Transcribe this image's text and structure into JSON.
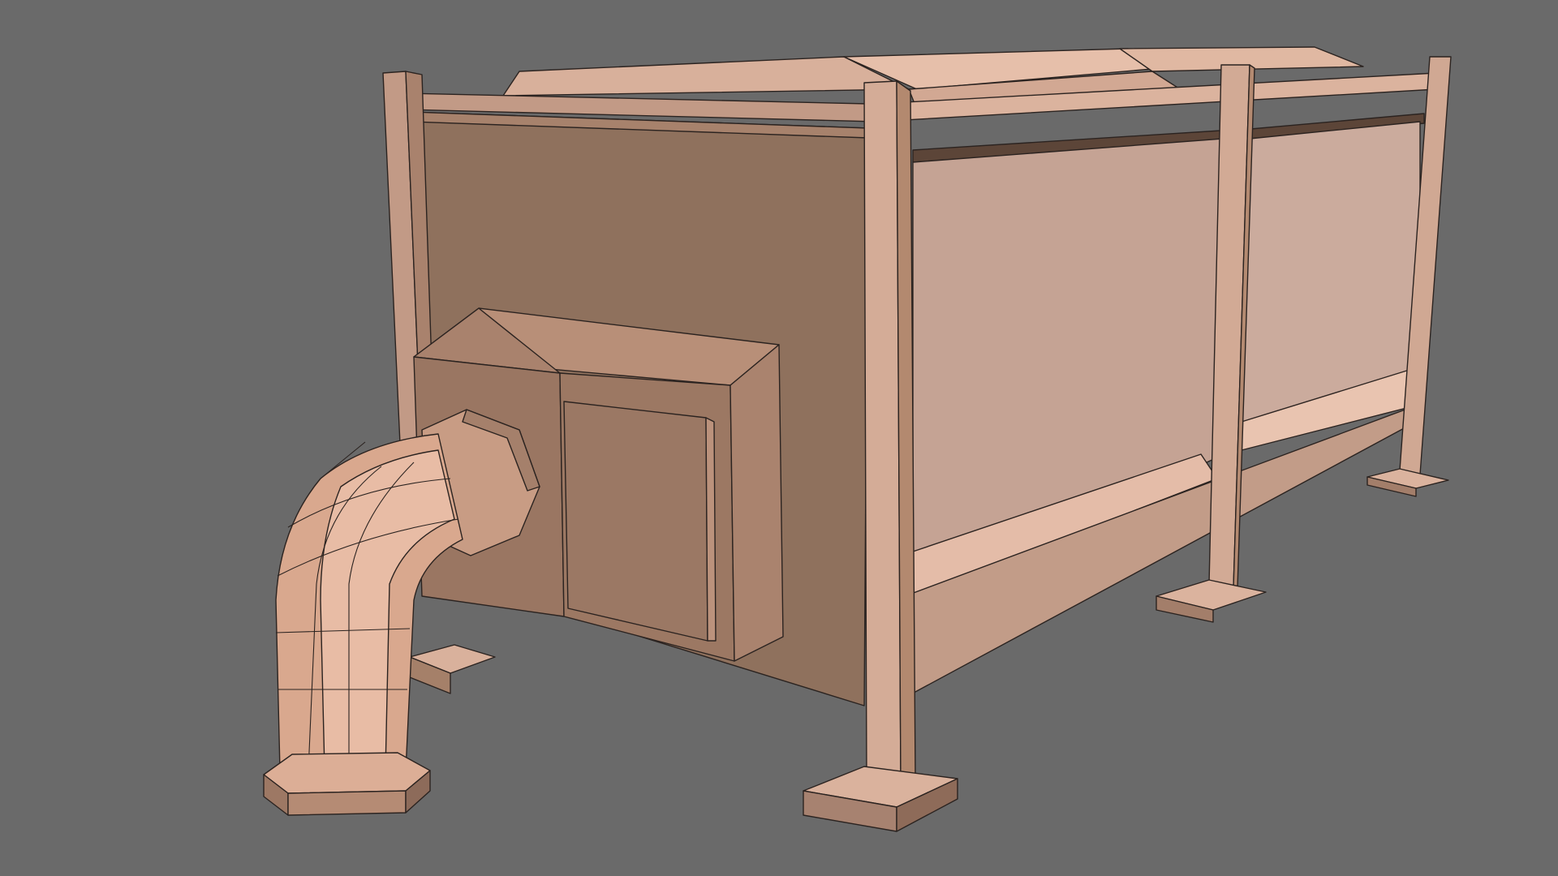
{
  "scene": {
    "colors": {
      "background": "#6a6a6a",
      "edge": "#2b2320",
      "surface_dark": "#8f715d",
      "surface_mid": "#b8917c",
      "surface_light": "#c8a899",
      "surface_highlight": "#ebc3ae"
    }
  }
}
